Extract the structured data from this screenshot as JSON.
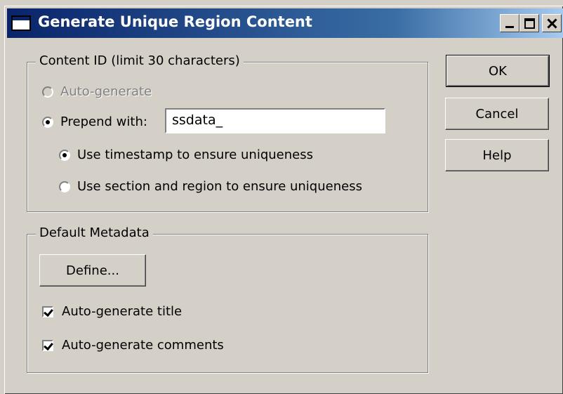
{
  "window": {
    "title": "Generate Unique Region Content"
  },
  "content_id_group": {
    "legend": "Content ID (limit 30 characters)",
    "auto_generate_label": "Auto-generate",
    "prepend_label": "Prepend with:",
    "prepend_value": "ssdata_",
    "timestamp_label": "Use timestamp to ensure uniqueness",
    "section_region_label": "Use section and region to ensure uniqueness"
  },
  "metadata_group": {
    "legend": "Default Metadata",
    "define_label": "Define...",
    "auto_title_label": "Auto-generate title",
    "auto_comments_label": "Auto-generate comments"
  },
  "buttons": {
    "ok": "OK",
    "cancel": "Cancel",
    "help": "Help"
  },
  "state": {
    "auto_generate_checked": false,
    "auto_generate_enabled": false,
    "prepend_checked": true,
    "timestamp_checked": true,
    "section_region_checked": false,
    "auto_title_checked": true,
    "auto_comments_checked": true
  }
}
